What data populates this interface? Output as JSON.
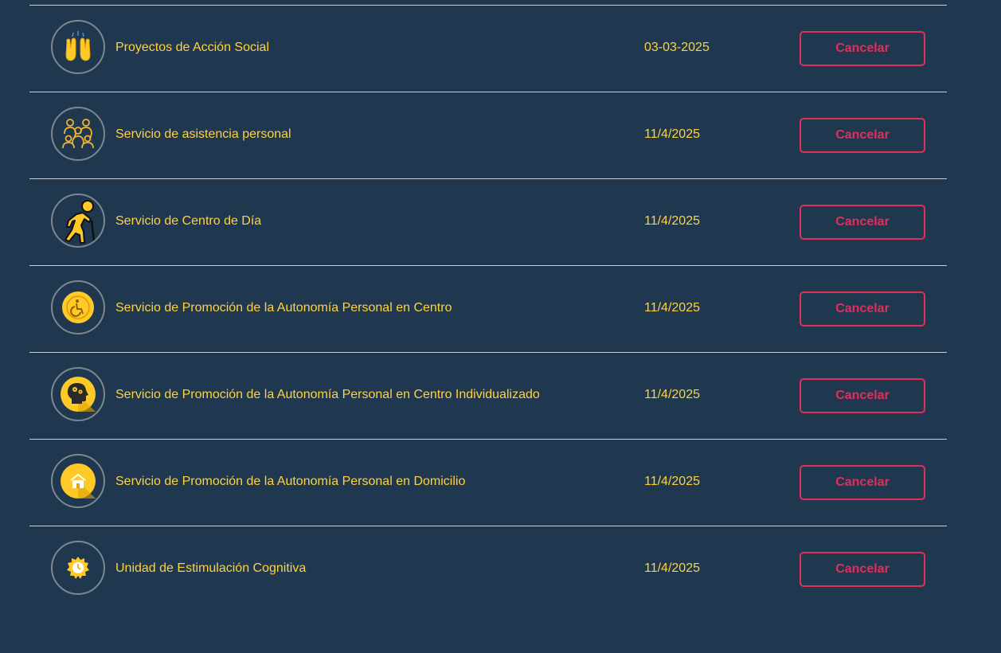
{
  "colors": {
    "background": "#1f374f",
    "text_accent": "#ffd23f",
    "cancel": "#e0305a",
    "divider": "#c9d1da"
  },
  "services": [
    {
      "name": "Proyectos de Acción Social",
      "date": "03-03-2025",
      "icon": "raised-hands-icon",
      "action": "Cancelar"
    },
    {
      "name": "Servicio de asistencia personal",
      "date": "11/4/2025",
      "icon": "people-group-icon",
      "action": "Cancelar"
    },
    {
      "name": "Servicio de Centro de Día",
      "date": "11/4/2025",
      "icon": "elderly-person-cane-icon",
      "action": "Cancelar"
    },
    {
      "name": "Servicio de Promoción de la Autonomía Personal en Centro",
      "date": "11/4/2025",
      "icon": "wheelchair-icon",
      "action": "Cancelar"
    },
    {
      "name": "Servicio de Promoción de la Autonomía Personal en Centro Individualizado",
      "date": "11/4/2025",
      "icon": "head-gears-icon",
      "action": "Cancelar"
    },
    {
      "name": "Servicio de Promoción de la Autonomía Personal en Domicilio",
      "date": "11/4/2025",
      "icon": "house-icon",
      "action": "Cancelar"
    },
    {
      "name": "Unidad de Estimulación Cognitiva",
      "date": "11/4/2025",
      "icon": "clock-badge-icon",
      "action": "Cancelar"
    }
  ]
}
